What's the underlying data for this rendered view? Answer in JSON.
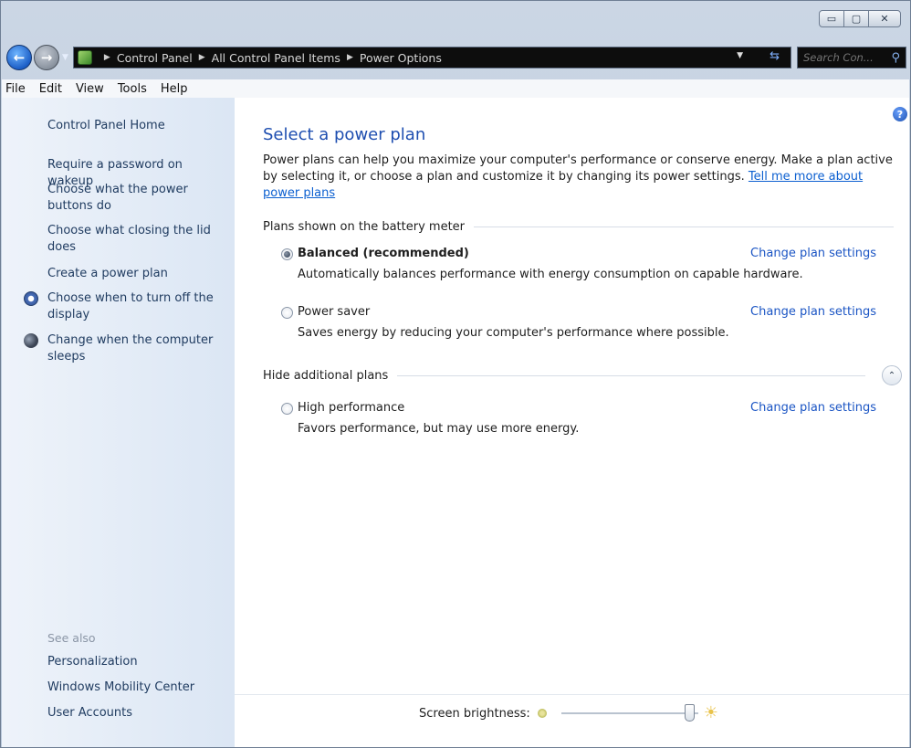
{
  "window": {
    "controls": {
      "minimize": "▭",
      "maximize": "▢",
      "close": "✕"
    }
  },
  "address_bar": {
    "crumbs": [
      "Control Panel",
      "All Control Panel Items",
      "Power Options"
    ],
    "search_placeholder": "Search Con..."
  },
  "menu": [
    "File",
    "Edit",
    "View",
    "Tools",
    "Help"
  ],
  "left_pane": {
    "home": "Control Panel Home",
    "links": [
      "Require a password on wakeup",
      "Choose what the power buttons do",
      "Choose what closing the lid does",
      "Create a power plan",
      "Choose when to turn off the display",
      "Change when the computer sleeps"
    ],
    "see_also_label": "See also",
    "see_also": [
      "Personalization",
      "Windows Mobility Center",
      "User Accounts"
    ]
  },
  "main": {
    "title": "Select a power plan",
    "intro": "Power plans can help you maximize your computer's performance or conserve energy. Make a plan active by selecting it, or choose a plan and customize it by changing its power settings.",
    "intro_link": "Tell me more about power plans",
    "battery_group": "Plans shown on the battery meter",
    "additional_group": "Hide additional plans",
    "change_label": "Change plan settings",
    "plans": [
      {
        "name": "Balanced (recommended)",
        "desc": "Automatically balances performance with energy consumption on capable hardware.",
        "selected": true
      },
      {
        "name": "Power saver",
        "desc": "Saves energy by reducing your computer's performance where possible.",
        "selected": false
      },
      {
        "name": "High performance",
        "desc": "Favors performance, but may use more energy.",
        "selected": false
      }
    ]
  },
  "footer": {
    "brightness_label": "Screen brightness:",
    "brightness_level": 0.97
  },
  "icons": {
    "back": "back-arrow-icon",
    "forward": "forward-arrow-icon",
    "search": "search-icon",
    "help": "help-icon",
    "display_timer": "clock-icon",
    "sleep": "moon-icon"
  }
}
